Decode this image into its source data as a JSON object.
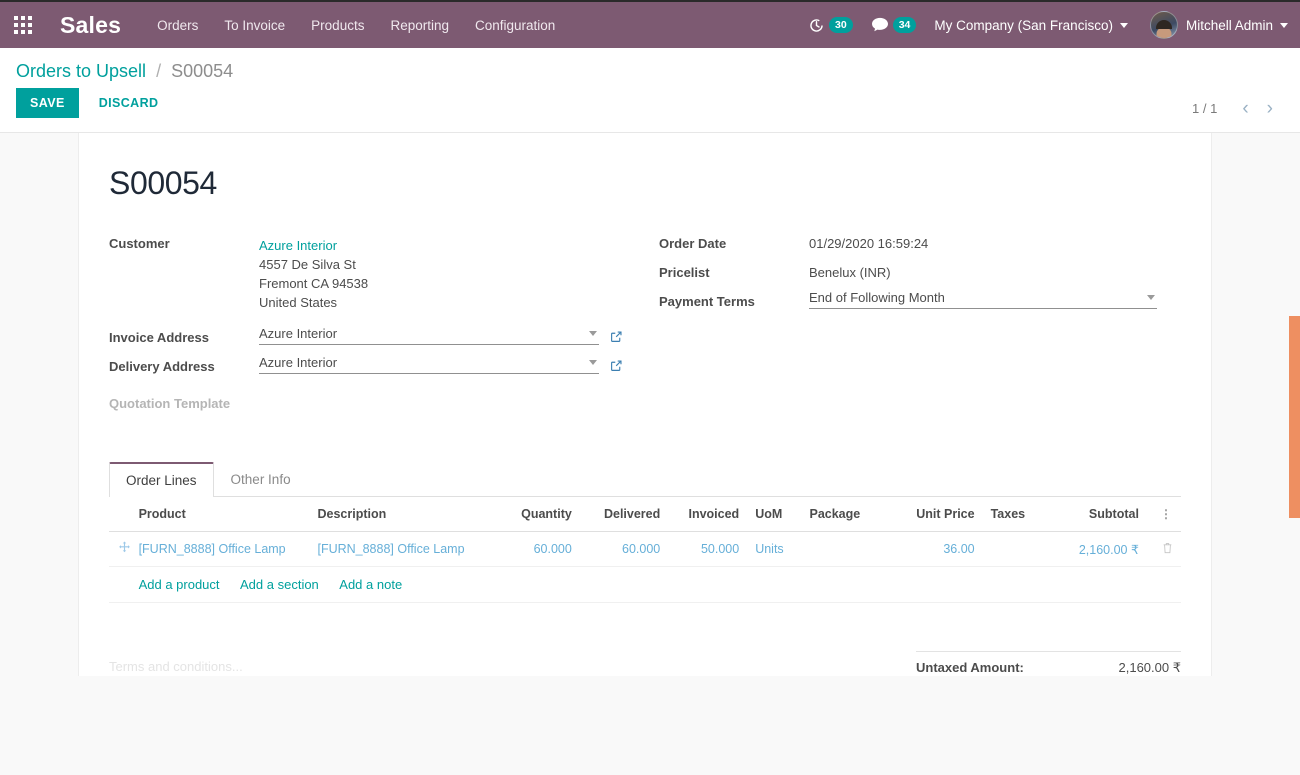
{
  "navbar": {
    "apps_icon": "grid-apps-icon",
    "brand": "Sales",
    "menu_items": [
      {
        "label": "Orders"
      },
      {
        "label": "To Invoice"
      },
      {
        "label": "Products"
      },
      {
        "label": "Reporting"
      },
      {
        "label": "Configuration"
      }
    ],
    "activities": {
      "icon": "clock-icon",
      "count": "30"
    },
    "messages": {
      "icon": "chat-bubble-icon",
      "count": "34"
    },
    "company": "My Company (San Francisco)",
    "user": "Mitchell Admin",
    "colors": {
      "navbar_bg": "#7d5a72",
      "badge_bg": "#00a09d"
    }
  },
  "control_panel": {
    "breadcrumb_parent": "Orders to Upsell",
    "breadcrumb_separator": "/",
    "breadcrumb_current": "S00054",
    "save_label": "SAVE",
    "discard_label": "DISCARD",
    "pager_value": "1 / 1",
    "pager_prev_icon": "chevron-left-icon",
    "pager_next_icon": "chevron-right-icon"
  },
  "form": {
    "title": "S00054",
    "left": {
      "customer_label": "Customer",
      "customer_name": "Azure Interior",
      "customer_address": [
        "4557 De Silva St",
        "Fremont CA 94538",
        "United States"
      ],
      "invoice_address_label": "Invoice Address",
      "invoice_address_value": "Azure Interior",
      "delivery_address_label": "Delivery Address",
      "delivery_address_value": "Azure Interior",
      "quotation_template_label": "Quotation Template",
      "quotation_template_value": ""
    },
    "right": {
      "order_date_label": "Order Date",
      "order_date_value": "01/29/2020 16:59:24",
      "pricelist_label": "Pricelist",
      "pricelist_value": "Benelux (INR)",
      "payment_terms_label": "Payment Terms",
      "payment_terms_value": "End of Following Month"
    }
  },
  "notebook": {
    "tabs": [
      {
        "label": "Order Lines",
        "active": true
      },
      {
        "label": "Other Info",
        "active": false
      }
    ],
    "columns": [
      "Product",
      "Description",
      "Quantity",
      "Delivered",
      "Invoiced",
      "UoM",
      "Package",
      "Unit Price",
      "Taxes",
      "Subtotal"
    ],
    "optional_columns_icon": "vertical-dots-icon",
    "rows": [
      {
        "drag_icon": "drag-move-icon",
        "product": "[FURN_8888] Office Lamp",
        "description": "[FURN_8888] Office Lamp",
        "quantity": "60.000",
        "delivered": "60.000",
        "invoiced": "50.000",
        "uom": "Units",
        "package": "",
        "unit_price": "36.00",
        "taxes": "",
        "subtotal": "2,160.00 ₹",
        "delete_icon": "trash-icon"
      }
    ],
    "add_links": [
      {
        "label": "Add a product"
      },
      {
        "label": "Add a section"
      },
      {
        "label": "Add a note"
      }
    ]
  },
  "bottom": {
    "terms_placeholder": "Terms and conditions...",
    "untaxed_label": "Untaxed Amount:",
    "untaxed_value": "2,160.00 ₹"
  },
  "scrollbar": {
    "thumb_color": "#ee8f61"
  }
}
